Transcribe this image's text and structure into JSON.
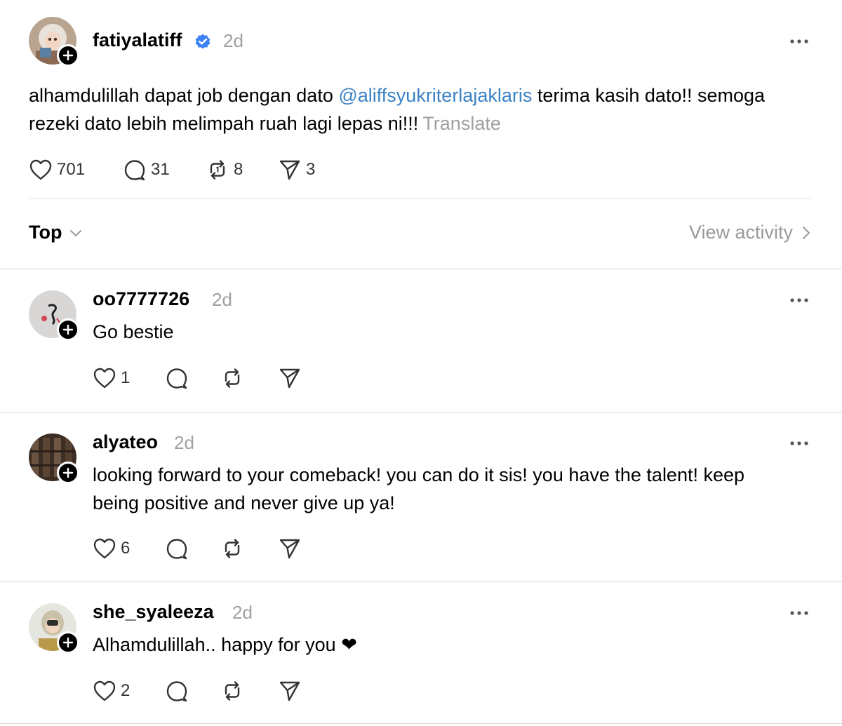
{
  "post": {
    "username": "fatiyalatiff",
    "time": "2d",
    "text_before": "alhamdulillah dapat job dengan dato ",
    "mention": "@aliffsyukriterlajaklaris",
    "text_after": " terima kasih dato!! semoga rezeki dato lebih melimpah ruah lagi lepas ni!!!",
    "translate": "Translate",
    "likes": "701",
    "replies": "31",
    "reposts": "8",
    "shares": "3"
  },
  "sort": {
    "label": "Top"
  },
  "activity": {
    "label": "View activity"
  },
  "replies": [
    {
      "username": "oo7777726",
      "time": "2d",
      "text": "Go bestie",
      "likes": "1"
    },
    {
      "username": "alyateo",
      "time": "2d",
      "text": "looking forward to your comeback! you can do it sis! you have the talent! keep being positive and never give up ya!",
      "likes": "6"
    },
    {
      "username": "she_syaleeza",
      "time": "2d",
      "text": "Alhamdulillah.. happy for you ❤",
      "likes": "2"
    }
  ],
  "colors": {
    "mention": "#3b82c4",
    "verified": "#3b82f6",
    "muted": "#a0a0a0"
  }
}
